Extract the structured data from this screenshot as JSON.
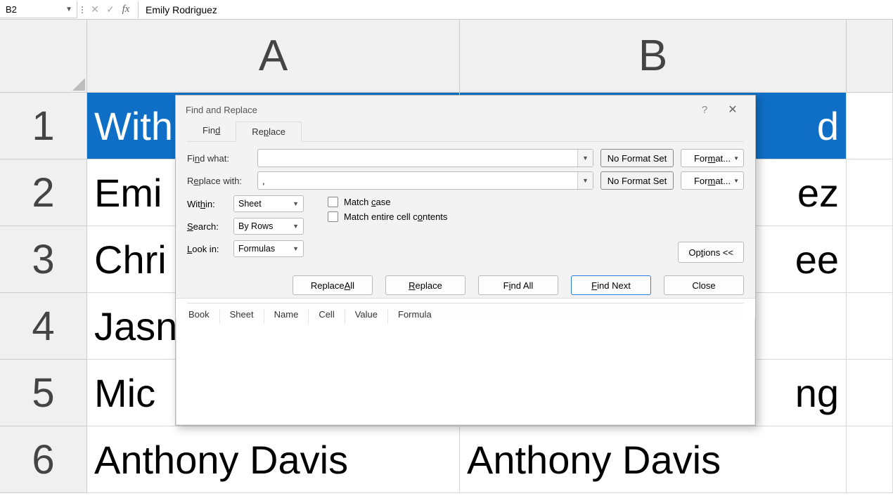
{
  "formula_bar": {
    "cell_ref": "B2",
    "cancel_glyph": "✕",
    "confirm_glyph": "✓",
    "fx_label": "fx",
    "value": "Emily Rodriguez"
  },
  "columns": [
    "A",
    "B"
  ],
  "rows": [
    "1",
    "2",
    "3",
    "4",
    "5",
    "6"
  ],
  "cells": {
    "A1": "With",
    "B1": "d",
    "A2": "Emi",
    "B2": "ez",
    "A3": "Chri",
    "B3": "ee",
    "A4": "Jasn",
    "B4": "",
    "A5": "Mic",
    "B5": "ng",
    "A6": "Anthony Davis",
    "B6": "Anthony Davis"
  },
  "dialog": {
    "title": "Find and Replace",
    "help_glyph": "?",
    "close_glyph": "✕",
    "tab_find": "Find",
    "tab_replace": "Replace",
    "find_what_label": "Find what:",
    "find_what_value": "",
    "replace_with_label": "Replace with:",
    "replace_with_value": ",",
    "no_format": "No Format Set",
    "format_btn": "Format...",
    "within_label": "Within:",
    "within_value": "Sheet",
    "search_label": "Search:",
    "search_value": "By Rows",
    "lookin_label": "Look in:",
    "lookin_value": "Formulas",
    "match_case": "Match case",
    "match_entire": "Match entire cell contents",
    "options_btn": "Options <<",
    "replace_all_btn": "Replace All",
    "replace_btn": "Replace",
    "find_all_btn": "Find All",
    "find_next_btn": "Find Next",
    "close_btn": "Close",
    "results_cols": [
      "Book",
      "Sheet",
      "Name",
      "Cell",
      "Value",
      "Formula"
    ]
  }
}
